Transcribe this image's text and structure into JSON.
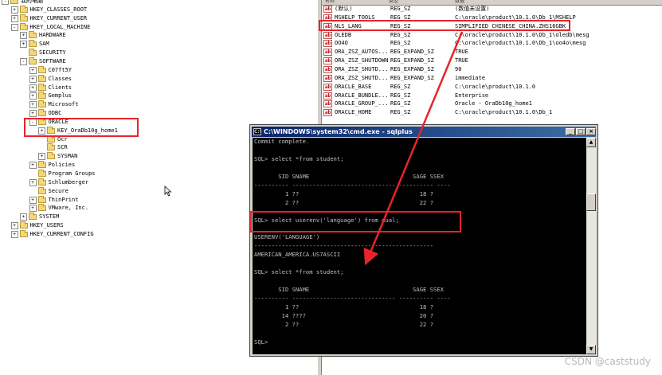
{
  "tree": {
    "items": [
      {
        "label": "我的电脑",
        "level": 0,
        "exp": "-"
      },
      {
        "label": "HKEY_CLASSES_ROOT",
        "level": 1,
        "exp": "+"
      },
      {
        "label": "HKEY_CURRENT_USER",
        "level": 1,
        "exp": "+"
      },
      {
        "label": "HKEY_LOCAL_MACHINE",
        "level": 1,
        "exp": "-"
      },
      {
        "label": "HARDWARE",
        "level": 2,
        "exp": "+"
      },
      {
        "label": "SAM",
        "level": 2,
        "exp": "+"
      },
      {
        "label": "SECURITY",
        "level": 2,
        "exp": ""
      },
      {
        "label": "SOFTWARE",
        "level": 2,
        "exp": "-"
      },
      {
        "label": "C07ft5Y",
        "level": 3,
        "exp": "+"
      },
      {
        "label": "Classes",
        "level": 3,
        "exp": "+"
      },
      {
        "label": "Clients",
        "level": 3,
        "exp": "+"
      },
      {
        "label": "Gemplus",
        "level": 3,
        "exp": "+"
      },
      {
        "label": "Microsoft",
        "level": 3,
        "exp": "+"
      },
      {
        "label": "ODBC",
        "level": 3,
        "exp": "+"
      },
      {
        "label": "ORACLE",
        "level": 3,
        "exp": "-"
      },
      {
        "label": "KEY_OraDb10g_home1",
        "level": 4,
        "exp": "+"
      },
      {
        "label": "Ocr",
        "level": 4,
        "exp": ""
      },
      {
        "label": "SCR",
        "level": 4,
        "exp": ""
      },
      {
        "label": "SYSMAN",
        "level": 4,
        "exp": "+"
      },
      {
        "label": "Policies",
        "level": 3,
        "exp": "+"
      },
      {
        "label": "Program Groups",
        "level": 3,
        "exp": ""
      },
      {
        "label": "Schlumberger",
        "level": 3,
        "exp": "+"
      },
      {
        "label": "Secure",
        "level": 3,
        "exp": ""
      },
      {
        "label": "ThinPrint",
        "level": 3,
        "exp": "+"
      },
      {
        "label": "VMware, Inc.",
        "level": 3,
        "exp": "+"
      },
      {
        "label": "SYSTEM",
        "level": 2,
        "exp": "+"
      },
      {
        "label": "HKEY_USERS",
        "level": 1,
        "exp": "+"
      },
      {
        "label": "HKEY_CURRENT_CONFIG",
        "level": 1,
        "exp": "+"
      }
    ]
  },
  "values_pane": {
    "columns": [
      "名称",
      "类型",
      "数据"
    ],
    "rows": [
      {
        "name": "(默认)",
        "type": "REG_SZ",
        "data": "(数值未设置)"
      },
      {
        "name": "MSHELP_TOOLS",
        "type": "REG_SZ",
        "data": "C:\\oracle\\product\\10.1.0\\Db_1\\MSHELP"
      },
      {
        "name": "NLS_LANG",
        "type": "REG_SZ",
        "data": "SIMPLIFIED CHINESE_CHINA.ZHS16GBK"
      },
      {
        "name": "OLEDB",
        "type": "REG_SZ",
        "data": "C:\\oracle\\product\\10.1.0\\Db_1\\oledb\\mesg"
      },
      {
        "name": "OO4O",
        "type": "REG_SZ",
        "data": "C:\\oracle\\product\\10.1.0\\Db_1\\oo4o\\mesg"
      },
      {
        "name": "ORA_ZSZ_AUTOS...",
        "type": "REG_EXPAND_SZ",
        "data": "TRUE"
      },
      {
        "name": "ORA_ZSZ_SHUTDOWN",
        "type": "REG_EXPAND_SZ",
        "data": "TRUE"
      },
      {
        "name": "ORA_ZSZ_SHUTD...",
        "type": "REG_EXPAND_SZ",
        "data": "90"
      },
      {
        "name": "ORA_ZSZ_SHUTD...",
        "type": "REG_EXPAND_SZ",
        "data": "immediate"
      },
      {
        "name": "ORACLE_BASE",
        "type": "REG_SZ",
        "data": "C:\\oracle\\product\\10.1.0"
      },
      {
        "name": "ORACLE_BUNDLE...",
        "type": "REG_SZ",
        "data": "Enterprise"
      },
      {
        "name": "ORACLE_GROUP_...",
        "type": "REG_SZ",
        "data": "Oracle - OraDb10g_home1"
      },
      {
        "name": "ORACLE_HOME",
        "type": "REG_SZ",
        "data": "C:\\oracle\\product\\10.1.0\\Db_1"
      }
    ]
  },
  "cmd": {
    "title": "C:\\WINDOWS\\system32\\cmd.exe - sqlplus",
    "minimize": "_",
    "maximize": "□",
    "close": "×",
    "lines": [
      "Commit complete.",
      "",
      "SQL> select *from student;",
      "",
      "       SID SNAME                              SAGE SSEX",
      "---------- ------------------------------ ---------- ----",
      "         1 ??                                   18 ?",
      "         2 ??                                   22 ?",
      "",
      "SQL> select userenv('language') from dual;",
      "",
      "USERENV('LANGUAGE')",
      "----------------------------------------------------",
      "AMERICAN_AMERICA.US7ASCII",
      "",
      "SQL> select *from student;",
      "",
      "       SID SNAME                              SAGE SSEX",
      "---------- ------------------------------ ---------- ----",
      "         1 ??                                   18 ?",
      "        14 ????                                 20 ?",
      "         2 ??                                   22 ?",
      "",
      "SQL> "
    ]
  },
  "watermark": "CSDN @caststudy",
  "colors": {
    "highlight": "#e8242a",
    "console_bg": "#000000",
    "console_text": "#c0c0c0",
    "title_bar": "#0a246a"
  }
}
